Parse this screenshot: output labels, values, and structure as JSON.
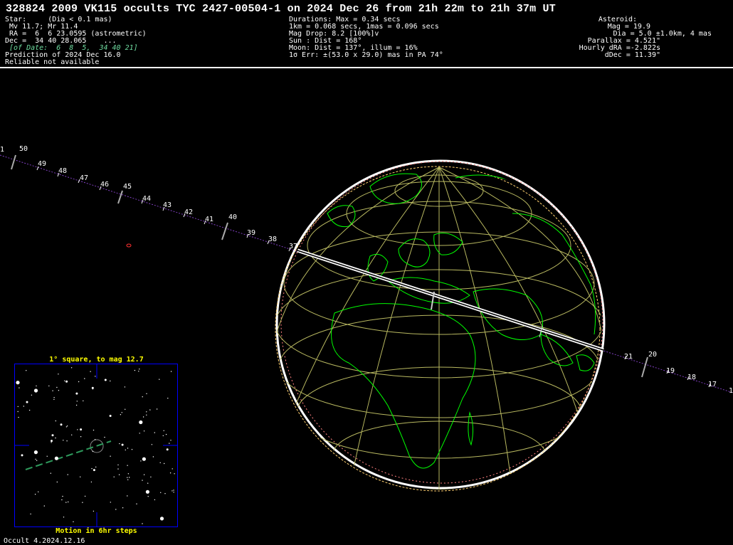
{
  "header": {
    "title": "328824 2009 VK115 occults TYC 2427-00504-1 on 2024 Dec 26 from 21h 22m to 21h 37m UT",
    "left_lines": [
      "Star:     (Dia < 0.1 mas)",
      " Mv 11.7; Mr 11.4",
      " RA =  6  6 23.0595 (astrometric)",
      "Dec =  34 40 28.065    ..."
    ],
    "left_of_date": " [of Date:  6  8  5,  34 40 21]",
    "left_lines_2": [
      "Prediction of 2024 Dec 16.0",
      "Reliable not available"
    ],
    "mid_lines": [
      "Durations: Max = 0.34 secs",
      "1km = 0.068 secs, 1mas = 0.096 secs",
      "Mag Drop: 8.2 [100%]v",
      "Sun : Dist = 168°",
      "Moon: Dist = 137°, illum = 16%",
      "1σ Err: ±(53.0 x 29.0) mas in PA 74°"
    ],
    "right_lines": [
      "Asteroid:",
      "Mag = 19.9",
      "Dia = 5.0 ±1.0km, 4 mas",
      "Parallax = 4.521\"",
      "Hourly dRA =-2.822s",
      "dDec = 11.39\""
    ]
  },
  "path_minutes_left": [
    "1",
    "50",
    "49",
    "48",
    "47",
    "46",
    "45",
    "44",
    "43",
    "42",
    "41",
    "40",
    "39",
    "38",
    "37"
  ],
  "path_minutes_right": [
    "21",
    "20",
    "19",
    "18",
    "17",
    "1"
  ],
  "inset": {
    "title": "1° square, to mag 12.7",
    "footer": "Motion in 6hr steps"
  },
  "footer": "Occult 4.2024.12.16",
  "colors": {
    "coast": "#00ff00",
    "grid": "#b8b860",
    "path_track": "#8040c0",
    "inset_frame": "#0000ff",
    "inset_text": "#ffff00",
    "motion": "#2e9a5c"
  }
}
